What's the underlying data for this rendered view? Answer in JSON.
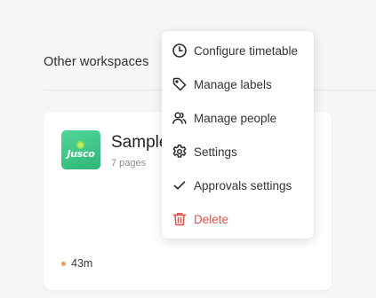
{
  "section": {
    "title": "Other workspaces"
  },
  "workspace": {
    "logo_text": "Jusco",
    "name": "Sample",
    "pages": "7 pages",
    "time": "43m",
    "colors": {
      "logo": "#3cc386",
      "status_dot": "#f39a4a"
    }
  },
  "menu": {
    "items": [
      {
        "label": "Configure timetable",
        "icon": "clock-icon"
      },
      {
        "label": "Manage labels",
        "icon": "tag-icon"
      },
      {
        "label": "Manage people",
        "icon": "people-icon"
      },
      {
        "label": "Settings",
        "icon": "gear-icon"
      },
      {
        "label": "Approvals settings",
        "icon": "check-icon"
      },
      {
        "label": "Delete",
        "icon": "trash-icon",
        "color": "#e2524b"
      }
    ]
  }
}
